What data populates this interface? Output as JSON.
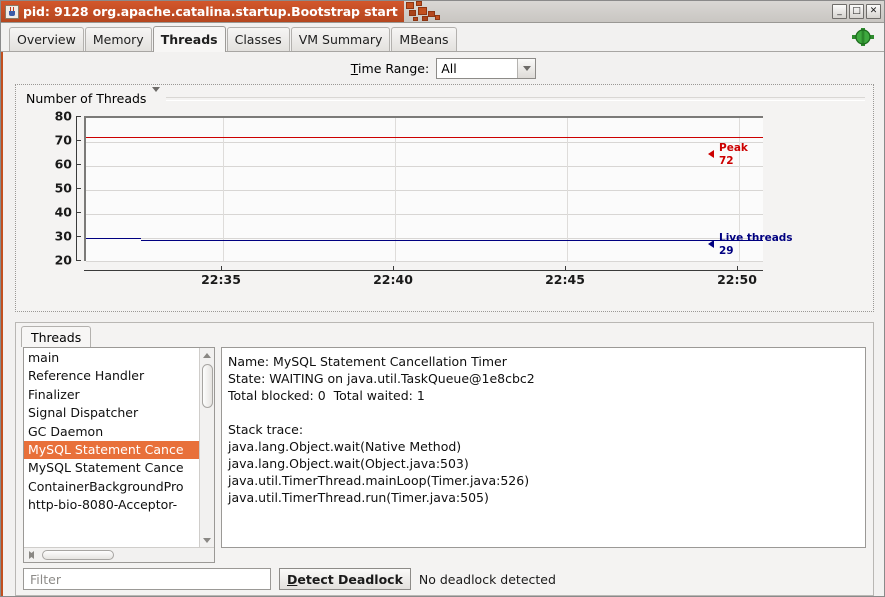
{
  "window": {
    "title": "pid: 9128 org.apache.catalina.startup.Bootstrap start",
    "app_icon": "java-cup-icon",
    "controls": {
      "minimize": "_",
      "maximize": "□",
      "close": "✕"
    },
    "titlebar_color": "#c2501f"
  },
  "tabs": [
    {
      "label": "Overview",
      "active": false
    },
    {
      "label": "Memory",
      "active": false
    },
    {
      "label": "Threads",
      "active": true
    },
    {
      "label": "Classes",
      "active": false
    },
    {
      "label": "VM Summary",
      "active": false
    },
    {
      "label": "MBeans",
      "active": false
    }
  ],
  "connection_icon": "connected-plug-icon",
  "time_range": {
    "label_prefix": "T",
    "label_rest": "ime Range:",
    "value": "All",
    "options": [
      "All"
    ]
  },
  "chart_panel": {
    "title": "Number of Threads",
    "dropdown_icon": "chevron-down-icon"
  },
  "chart_data": {
    "type": "line",
    "title": "Number of Threads",
    "xlabel": "",
    "ylabel": "",
    "ylim": [
      20,
      80
    ],
    "yticks": [
      20,
      30,
      40,
      50,
      60,
      70,
      80
    ],
    "xticks": [
      "22:35",
      "22:40",
      "22:45",
      "22:50"
    ],
    "grid": true,
    "legend_position": "right",
    "series": [
      {
        "name": "Peak",
        "value": 72,
        "color": "#cc0000",
        "legend_label": "Peak",
        "legend_value": "72",
        "values": [
          72,
          72,
          72,
          72,
          72,
          72,
          72,
          72,
          72,
          72
        ]
      },
      {
        "name": "Live threads",
        "value": 29,
        "color": "#000080",
        "legend_label": "Live threads",
        "legend_value": "29",
        "values": [
          30,
          30,
          29,
          29,
          29,
          29,
          29,
          29,
          29,
          29
        ]
      }
    ]
  },
  "threads_panel": {
    "tab_label": "Threads",
    "thread_list": [
      {
        "name": "main",
        "selected": false
      },
      {
        "name": "Reference Handler",
        "selected": false
      },
      {
        "name": "Finalizer",
        "selected": false
      },
      {
        "name": "Signal Dispatcher",
        "selected": false
      },
      {
        "name": "GC Daemon",
        "selected": false
      },
      {
        "name": "MySQL Statement Cance",
        "selected": true
      },
      {
        "name": "MySQL Statement Cance",
        "selected": false
      },
      {
        "name": "ContainerBackgroundPro",
        "selected": false
      },
      {
        "name": "http-bio-8080-Acceptor-",
        "selected": false
      }
    ],
    "detail": "Name: MySQL Statement Cancellation Timer\nState: WAITING on java.util.TaskQueue@1e8cbc2\nTotal blocked: 0  Total waited: 1\n\nStack trace:\njava.lang.Object.wait(Native Method)\njava.lang.Object.wait(Object.java:503)\njava.util.TimerThread.mainLoop(Timer.java:526)\njava.util.TimerThread.run(Timer.java:505)"
  },
  "bottom_bar": {
    "filter_placeholder": "Filter",
    "filter_value": "",
    "detect_deadlock_prefix": "D",
    "detect_deadlock_rest": "etect Deadlock",
    "deadlock_status": "No deadlock detected"
  }
}
